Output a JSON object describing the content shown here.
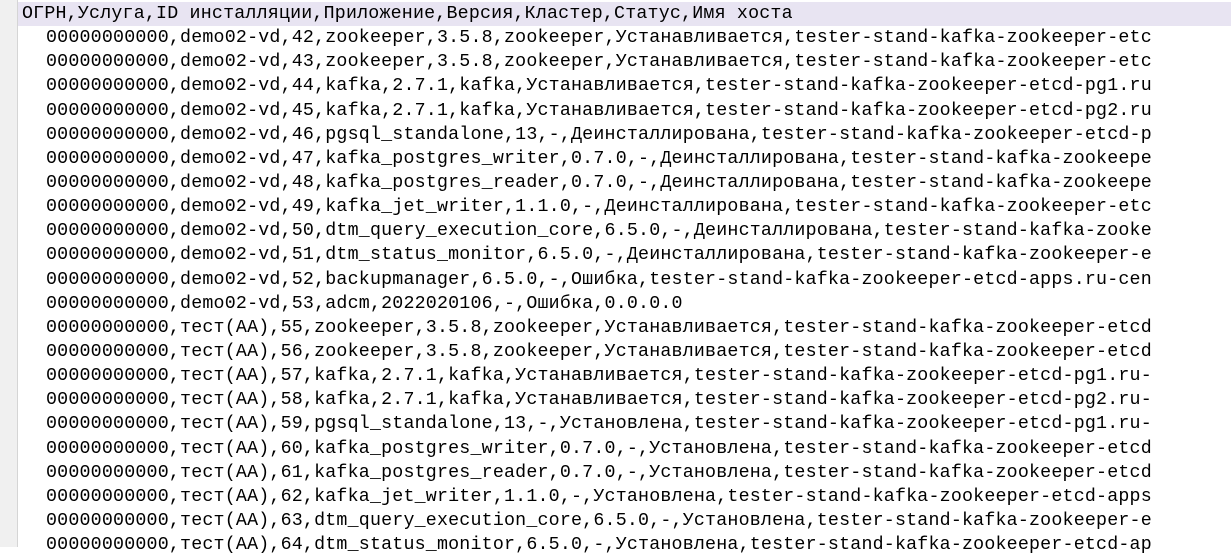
{
  "header": [
    "ОГРН",
    "Услуга",
    "ID инсталляции",
    "Приложение",
    "Версия",
    "Кластер",
    "Статус",
    "Имя хоста"
  ],
  "rows": [
    [
      "00000000000",
      "demo02-vd",
      "42",
      "zookeeper",
      "3.5.8",
      "zookeeper",
      "Устанавливается",
      "tester-stand-kafka-zookeeper-etc"
    ],
    [
      "00000000000",
      "demo02-vd",
      "43",
      "zookeeper",
      "3.5.8",
      "zookeeper",
      "Устанавливается",
      "tester-stand-kafka-zookeeper-etc"
    ],
    [
      "00000000000",
      "demo02-vd",
      "44",
      "kafka",
      "2.7.1",
      "kafka",
      "Устанавливается",
      "tester-stand-kafka-zookeeper-etcd-pg1.ru"
    ],
    [
      "00000000000",
      "demo02-vd",
      "45",
      "kafka",
      "2.7.1",
      "kafka",
      "Устанавливается",
      "tester-stand-kafka-zookeeper-etcd-pg2.ru"
    ],
    [
      "00000000000",
      "demo02-vd",
      "46",
      "pgsql_standalone",
      "13",
      "-",
      "Деинсталлирована",
      "tester-stand-kafka-zookeeper-etcd-p"
    ],
    [
      "00000000000",
      "demo02-vd",
      "47",
      "kafka_postgres_writer",
      "0.7.0",
      "-",
      "Деинсталлирована",
      "tester-stand-kafka-zookeepe"
    ],
    [
      "00000000000",
      "demo02-vd",
      "48",
      "kafka_postgres_reader",
      "0.7.0",
      "-",
      "Деинсталлирована",
      "tester-stand-kafka-zookeepe"
    ],
    [
      "00000000000",
      "demo02-vd",
      "49",
      "kafka_jet_writer",
      "1.1.0",
      "-",
      "Деинсталлирована",
      "tester-stand-kafka-zookeeper-etc"
    ],
    [
      "00000000000",
      "demo02-vd",
      "50",
      "dtm_query_execution_core",
      "6.5.0",
      "-",
      "Деинсталлирована",
      "tester-stand-kafka-zooke"
    ],
    [
      "00000000000",
      "demo02-vd",
      "51",
      "dtm_status_monitor",
      "6.5.0",
      "-",
      "Деинсталлирована",
      "tester-stand-kafka-zookeeper-e"
    ],
    [
      "00000000000",
      "demo02-vd",
      "52",
      "backupmanager",
      "6.5.0",
      "-",
      "Ошибка",
      "tester-stand-kafka-zookeeper-etcd-apps.ru-cen"
    ],
    [
      "00000000000",
      "demo02-vd",
      "53",
      "adcm",
      "2022020106",
      "-",
      "Ошибка",
      "0.0.0.0"
    ],
    [
      "00000000000",
      "тест(AA)",
      "55",
      "zookeeper",
      "3.5.8",
      "zookeeper",
      "Устанавливается",
      "tester-stand-kafka-zookeeper-etcd"
    ],
    [
      "00000000000",
      "тест(AA)",
      "56",
      "zookeeper",
      "3.5.8",
      "zookeeper",
      "Устанавливается",
      "tester-stand-kafka-zookeeper-etcd"
    ],
    [
      "00000000000",
      "тест(AA)",
      "57",
      "kafka",
      "2.7.1",
      "kafka",
      "Устанавливается",
      "tester-stand-kafka-zookeeper-etcd-pg1.ru-"
    ],
    [
      "00000000000",
      "тест(AA)",
      "58",
      "kafka",
      "2.7.1",
      "kafka",
      "Устанавливается",
      "tester-stand-kafka-zookeeper-etcd-pg2.ru-"
    ],
    [
      "00000000000",
      "тест(AA)",
      "59",
      "pgsql_standalone",
      "13",
      "-",
      "Установлена",
      "tester-stand-kafka-zookeeper-etcd-pg1.ru-"
    ],
    [
      "00000000000",
      "тест(AA)",
      "60",
      "kafka_postgres_writer",
      "0.7.0",
      "-",
      "Установлена",
      "tester-stand-kafka-zookeeper-etcd"
    ],
    [
      "00000000000",
      "тест(AA)",
      "61",
      "kafka_postgres_reader",
      "0.7.0",
      "-",
      "Установлена",
      "tester-stand-kafka-zookeeper-etcd"
    ],
    [
      "00000000000",
      "тест(AA)",
      "62",
      "kafka_jet_writer",
      "1.1.0",
      "-",
      "Установлена",
      "tester-stand-kafka-zookeeper-etcd-apps"
    ],
    [
      "00000000000",
      "тест(AA)",
      "63",
      "dtm_query_execution_core",
      "6.5.0",
      "-",
      "Установлена",
      "tester-stand-kafka-zookeeper-e"
    ],
    [
      "00000000000",
      "тест(AA)",
      "64",
      "dtm_status_monitor",
      "6.5.0",
      "-",
      "Установлена",
      "tester-stand-kafka-zookeeper-etcd-ap"
    ]
  ]
}
